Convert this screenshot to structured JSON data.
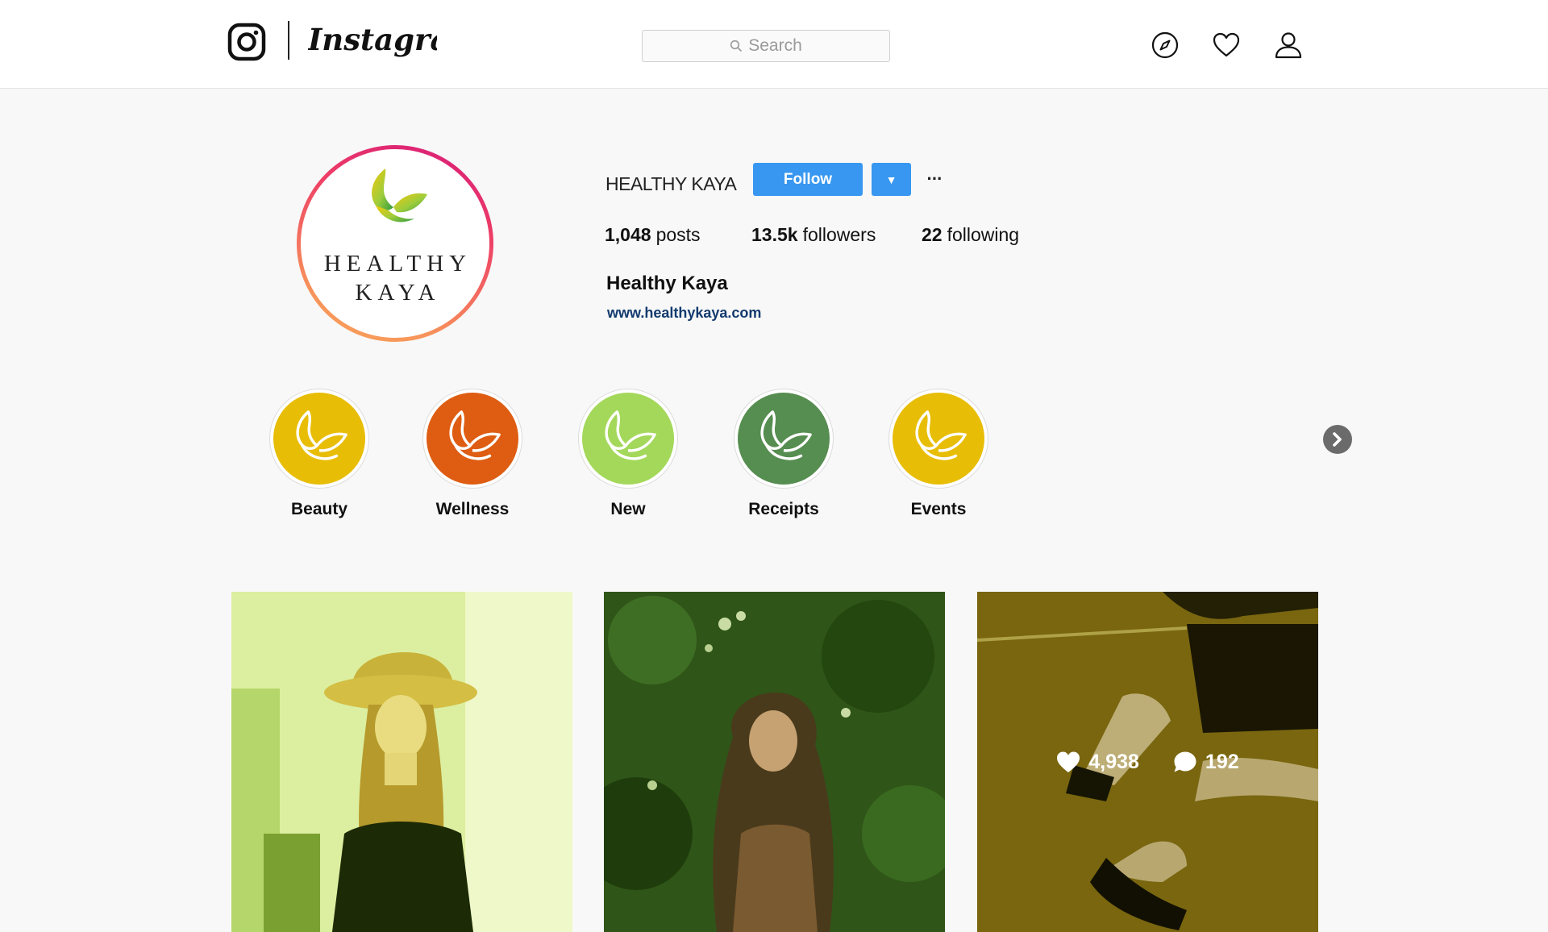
{
  "header": {
    "brand": "Instagram",
    "search_placeholder": "Search"
  },
  "profile": {
    "avatar_brand_line1": "HEALTHY",
    "avatar_brand_line2": "KAYA",
    "username": "HEALTHY KAYA",
    "follow_label": "Follow",
    "dropdown_glyph": "▼",
    "more_glyph": "···",
    "stats": {
      "posts_count": "1,048",
      "posts_label": "posts",
      "followers_count": "13.5k",
      "followers_label": "followers",
      "following_count": "22",
      "following_label": "following"
    },
    "full_name": "Healthy Kaya",
    "website": "www.healthykaya.com"
  },
  "highlights": [
    {
      "label": "Beauty",
      "color": "#e8bd06"
    },
    {
      "label": "Wellness",
      "color": "#de5d12"
    },
    {
      "label": "New",
      "color": "#a3d85a"
    },
    {
      "label": "Receipts",
      "color": "#568d50"
    },
    {
      "label": "Events",
      "color": "#e8bd06"
    }
  ],
  "posts": [
    {
      "description_icon": "photo",
      "tint": "#c8e27a"
    },
    {
      "description_icon": "photo",
      "tint": "#3d6a22"
    },
    {
      "description_icon": "photo",
      "tint": "#a58a1b",
      "likes": "4,938",
      "comments": "192"
    }
  ],
  "colors": {
    "accent": "#3897f0",
    "link": "#123a6e"
  }
}
